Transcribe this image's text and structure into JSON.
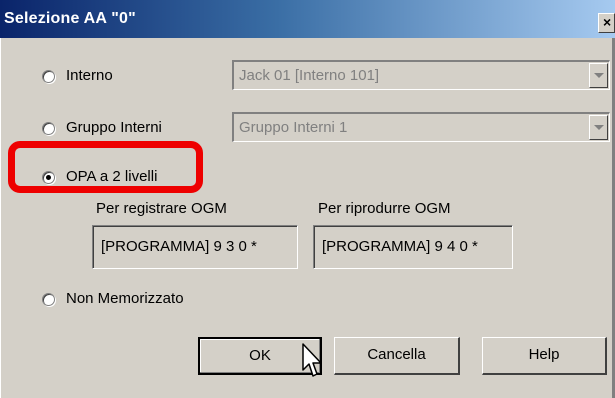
{
  "window": {
    "title": "Selezione AA \"0\"",
    "close_label": "×"
  },
  "options": [
    {
      "label": "Interno",
      "selected": false,
      "combo_value": "Jack 01 [Interno 101]"
    },
    {
      "label": "Gruppo Interni",
      "selected": false,
      "combo_value": "Gruppo Interni 1"
    },
    {
      "label": "OPA a 2 livelli",
      "selected": true
    },
    {
      "label": "Non Memorizzato",
      "selected": false
    }
  ],
  "opa": {
    "record_label": "Per registrare OGM",
    "record_value": "[PROGRAMMA] 9 3 0 *",
    "play_label": "Per riprodurre OGM",
    "play_value": "[PROGRAMMA] 9 4 0 *"
  },
  "buttons": {
    "ok": "OK",
    "cancel": "Cancella",
    "help": "Help"
  },
  "colors": {
    "highlight": "#ee0000",
    "titlebar_start": "#0a246a",
    "dialog_bg": "#d4d0c8"
  }
}
